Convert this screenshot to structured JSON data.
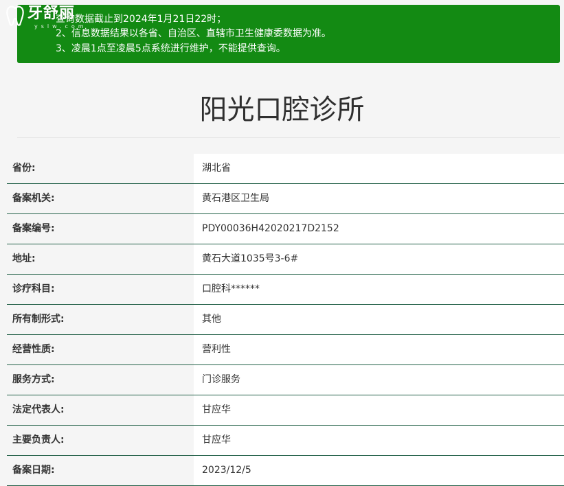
{
  "notice": {
    "line1": "查询数据截止到2024年1月21日22时；",
    "line2": "2、信息数据结果以各省、自治区、直辖市卫生健康委数据为准。",
    "line3": "3、凌晨1点至凌晨5点系统进行维护，不能提供查询。"
  },
  "logo": {
    "brand": "牙舒丽",
    "sub": "yslw.com"
  },
  "page_title": "阳光口腔诊所",
  "colors": {
    "notice_bg": "#138a13",
    "row_border": "#1f5e45",
    "label_bg": "#f5f5f5",
    "value_bg": "#ffffff"
  },
  "rows": [
    {
      "label": "省份:",
      "value": "湖北省"
    },
    {
      "label": "备案机关:",
      "value": "黄石港区卫生局"
    },
    {
      "label": "备案编号:",
      "value": "PDY00036H42020217D2152"
    },
    {
      "label": "地址:",
      "value": "黄石大道1035号3-6#"
    },
    {
      "label": "诊疗科目:",
      "value": "口腔科******"
    },
    {
      "label": "所有制形式:",
      "value": "其他"
    },
    {
      "label": "经营性质:",
      "value": "营利性"
    },
    {
      "label": "服务方式:",
      "value": "门诊服务"
    },
    {
      "label": "法定代表人:",
      "value": "甘应华"
    },
    {
      "label": "主要负责人:",
      "value": "甘应华"
    },
    {
      "label": "备案日期:",
      "value": "2023/12/5"
    }
  ]
}
